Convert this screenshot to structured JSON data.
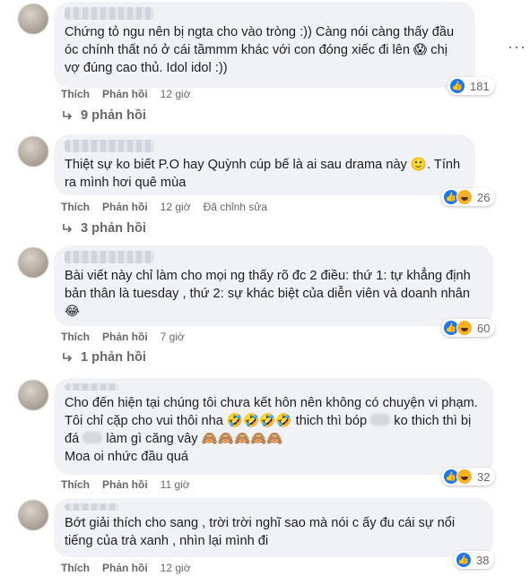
{
  "comments": [
    {
      "text": "Chứng tỏ ngu nên bị ngta cho vào tròng :)) Càng nói càng thấy đầu óc chính thất nó ở cái tầmmm khác với con đóng xiếc đi lên 😱 chị vợ đúng cao thủ. Idol idol :))",
      "like_label": "Thích",
      "reply_label": "Phản hồi",
      "time": "12 giờ",
      "edited": "",
      "reaction_count": "181",
      "replies_label": "9 phản hồi"
    },
    {
      "text": "Thiệt sự ko biết P.O hay Quỳnh cúp bế là ai sau drama này 🙂. Tính ra mình hơi quê mùa",
      "like_label": "Thích",
      "reply_label": "Phản hồi",
      "time": "12 giờ",
      "edited": "Đã chỉnh sửa",
      "reaction_count": "26",
      "replies_label": "3 phản hồi"
    },
    {
      "text": "Bài viết này chỉ làm cho mọi ng thấy rõ đc 2 điều: thứ 1: tự khẳng định bản thân là tuesday , thứ 2: sự khác biệt của diễn viên và doanh nhân 😂",
      "like_label": "Thích",
      "reply_label": "Phản hồi",
      "time": "7 giờ",
      "edited": "",
      "reaction_count": "60",
      "replies_label": "1 phản hồi"
    },
    {
      "text_part1": "Cho đến hiện tại chúng tôi chưa kết hôn nên không có chuyện vi phạm. Tôi chỉ cặp cho vui thôi nha 🤣🤣🤣🤣 thich thì bóp",
      "text_part2": "ko thich thì bị đá",
      "text_part3": "làm gì căng vây 🙈🙈🙈🙈🙈",
      "text_line4": "Moa oi nhức đầu quá",
      "like_label": "Thích",
      "reply_label": "Phản hồi",
      "time": "11 giờ",
      "reaction_count": "32"
    },
    {
      "text": "Bớt giải thích cho sang , trời trời nghĩ sao mà nói c ấy đu cái sự nổi tiếng của trà xanh , nhìn lại mình đi",
      "like_label": "Thích",
      "reply_label": "Phản hồi",
      "time": "12 giờ",
      "reaction_count": "38"
    }
  ],
  "icons": {
    "more": "more-options-icon",
    "like": "like-reaction-icon",
    "haha": "haha-reaction-icon",
    "reply_arrow": "reply-arrow-icon"
  },
  "colors": {
    "bubble": "#f0f2f5",
    "meta": "#65676b",
    "like_blue": "#1877f2",
    "haha_yellow": "#f7b125"
  }
}
